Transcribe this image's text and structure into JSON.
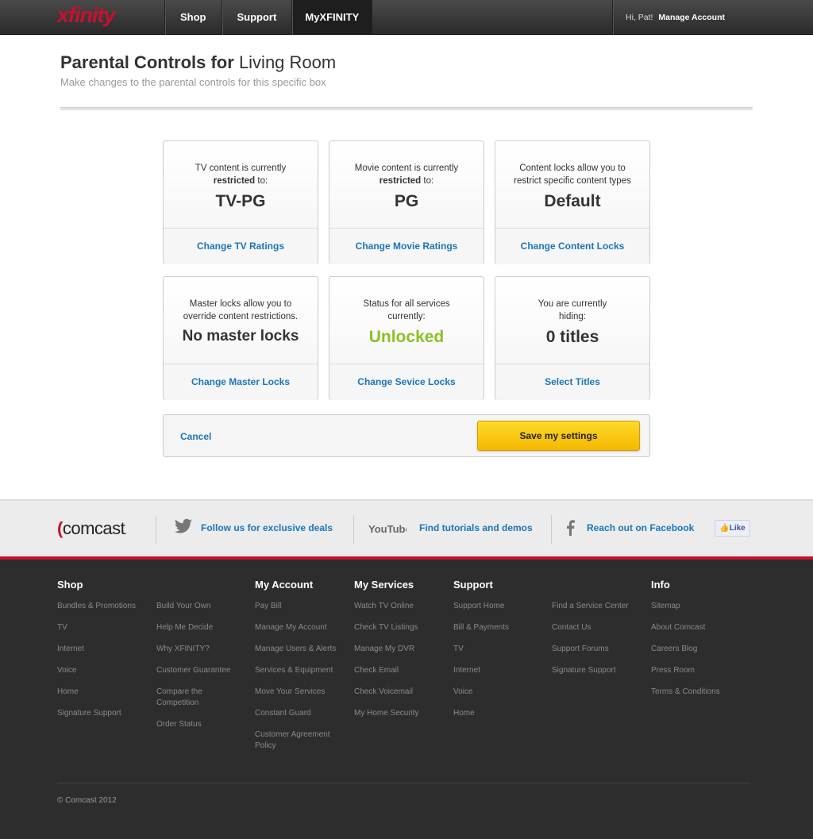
{
  "nav": {
    "logo": "xfinity",
    "items": [
      "Shop",
      "Support",
      "MyXFINITY"
    ],
    "greeting": "Hi, Pat!",
    "manage": "Manage Account"
  },
  "page": {
    "title_bold": "Parental Controls for",
    "title_rest": "Living Room",
    "subtitle": "Make changes to the parental controls for this specific box"
  },
  "cards": [
    {
      "desc1": "TV content is currently",
      "desc_bold": "restricted",
      "desc_rest": " to:",
      "value": "TV-PG",
      "link": "Change TV Ratings"
    },
    {
      "desc1": "Movie content is currently",
      "desc_bold": "restricted",
      "desc_rest": " to:",
      "value": "PG",
      "link": "Change Movie Ratings"
    },
    {
      "desc1": "Content locks allow you to restrict specific content types",
      "value": "Default",
      "link": "Change Content Locks"
    },
    {
      "desc1": "Master locks allow you to override content restrictions.",
      "value": "No master locks",
      "link": "Change Master Locks"
    },
    {
      "desc1": "Status for all services currently:",
      "value": "Unlocked",
      "link": "Change Sevice Locks"
    },
    {
      "desc1": "You are currently hiding:",
      "value": "0 titles",
      "link": "Select Titles"
    }
  ],
  "actions": {
    "cancel": "Cancel",
    "save": "Save my settings"
  },
  "social": {
    "logo": "comcast",
    "twitter": "Follow us for exclusive deals",
    "youtube_logo": "YouTube",
    "youtube": "Find tutorials and demos",
    "facebook": "Reach out on Facebook",
    "like": "Like"
  },
  "footer": {
    "shop": {
      "title": "Shop",
      "links": [
        "Bundles & Promotions",
        "TV",
        "Internet",
        "Voice",
        "Home",
        "Signature Support"
      ]
    },
    "shop2": {
      "links": [
        "Build Your Own",
        "Help Me Decide",
        "Why XFINITY?",
        "Customer Guarantee",
        "Compare the Competition",
        "Order Status"
      ]
    },
    "account": {
      "title": "My Account",
      "links": [
        "Pay Bill",
        "Manage My Account",
        "Manage Users & Alerts",
        "Services & Equipment",
        "Move Your Services",
        "Constant Guard",
        "Customer Agreement Policy"
      ]
    },
    "services": {
      "title": "My Services",
      "links": [
        "Watch TV Online",
        "Check TV Listings",
        "Manage My DVR",
        "Check Email",
        "Check Voicemail",
        "My Home Security"
      ]
    },
    "support": {
      "title": "Support",
      "links": [
        "Support Home",
        "Bill & Payments",
        "TV",
        "Internet",
        "Voice",
        "Home"
      ]
    },
    "support2": {
      "links": [
        "Find a Service Center",
        "Contact Us",
        "Support Forums",
        "Signature Support"
      ]
    },
    "info": {
      "title": "Info",
      "links": [
        "Sitemap",
        "About Comcast",
        "Careers Blog",
        "Press Room",
        "Terms & Conditions"
      ]
    },
    "copyright": "© Comcast 2012"
  },
  "colors": {
    "brand_red": "#c8102e",
    "link_blue": "#1b75bb",
    "status_green": "#8bc124",
    "save_yellow": "#ffd92a"
  }
}
